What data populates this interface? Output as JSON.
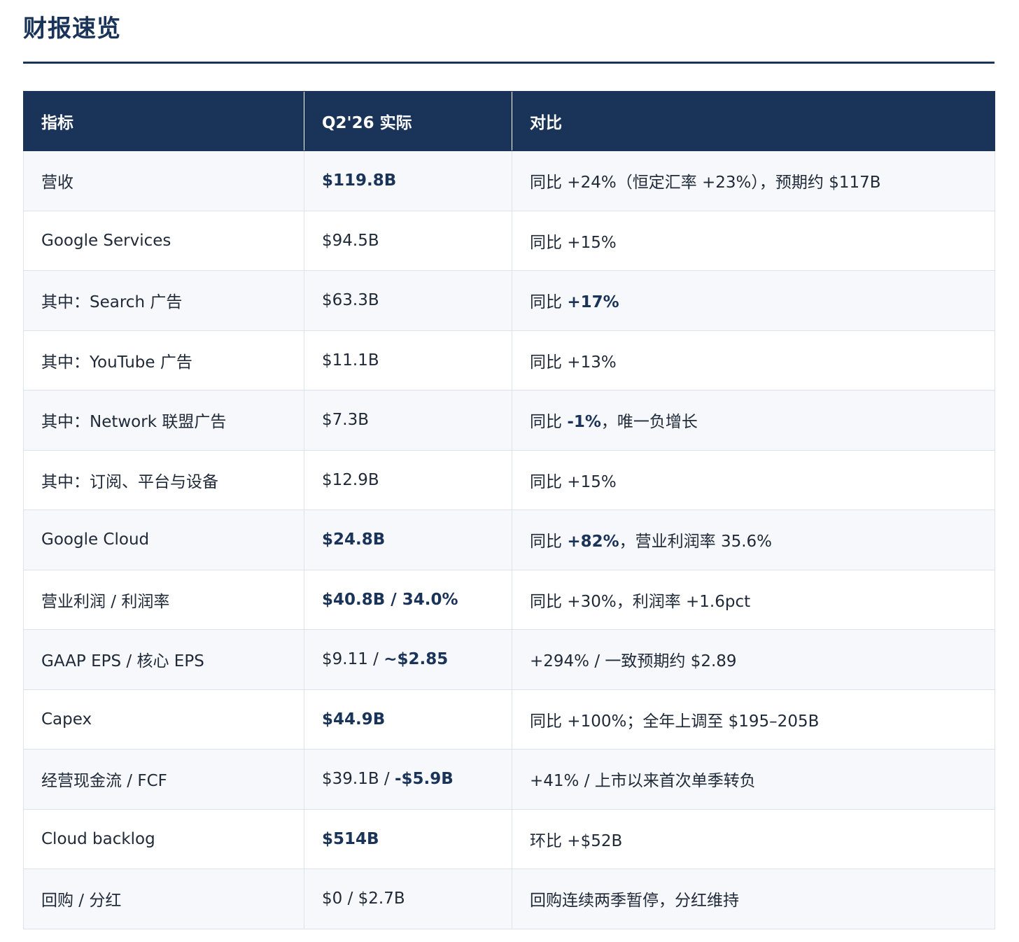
{
  "page": {
    "title": "财报速览"
  },
  "table": {
    "headers": [
      "指标",
      "Q2'26 实际",
      "对比"
    ],
    "rows": [
      {
        "metric": "营收",
        "actual": [
          {
            "text": "$119.8B",
            "bold": true
          }
        ],
        "comparison": [
          {
            "text": "同比 +24%（恒定汇率 +23%），预期约 $117B",
            "bold": false
          }
        ]
      },
      {
        "metric": "Google Services",
        "actual": [
          {
            "text": "$94.5B",
            "bold": false
          }
        ],
        "comparison": [
          {
            "text": "同比 +15%",
            "bold": false
          }
        ]
      },
      {
        "metric": "其中：Search 广告",
        "actual": [
          {
            "text": "$63.3B",
            "bold": false
          }
        ],
        "comparison": [
          {
            "text": "同比 ",
            "bold": false
          },
          {
            "text": "+17%",
            "bold": true
          }
        ]
      },
      {
        "metric": "其中：YouTube 广告",
        "actual": [
          {
            "text": "$11.1B",
            "bold": false
          }
        ],
        "comparison": [
          {
            "text": "同比 +13%",
            "bold": false
          }
        ]
      },
      {
        "metric": "其中：Network 联盟广告",
        "actual": [
          {
            "text": "$7.3B",
            "bold": false
          }
        ],
        "comparison": [
          {
            "text": "同比 ",
            "bold": false
          },
          {
            "text": "-1%",
            "bold": true
          },
          {
            "text": "，唯一负增长",
            "bold": false
          }
        ]
      },
      {
        "metric": "其中：订阅、平台与设备",
        "actual": [
          {
            "text": "$12.9B",
            "bold": false
          }
        ],
        "comparison": [
          {
            "text": "同比 +15%",
            "bold": false
          }
        ]
      },
      {
        "metric": "Google Cloud",
        "actual": [
          {
            "text": "$24.8B",
            "bold": true
          }
        ],
        "comparison": [
          {
            "text": "同比 ",
            "bold": false
          },
          {
            "text": "+82%",
            "bold": true
          },
          {
            "text": "，营业利润率 35.6%",
            "bold": false
          }
        ]
      },
      {
        "metric": "营业利润 / 利润率",
        "actual": [
          {
            "text": "$40.8B / 34.0%",
            "bold": true
          }
        ],
        "comparison": [
          {
            "text": "同比 +30%，利润率 +1.6pct",
            "bold": false
          }
        ]
      },
      {
        "metric": "GAAP EPS / 核心 EPS",
        "actual": [
          {
            "text": "$9.11 / ",
            "bold": false
          },
          {
            "text": "~$2.85",
            "bold": true
          }
        ],
        "comparison": [
          {
            "text": "+294% / 一致预期约 $2.89",
            "bold": false
          }
        ]
      },
      {
        "metric": "Capex",
        "actual": [
          {
            "text": "$44.9B",
            "bold": true
          }
        ],
        "comparison": [
          {
            "text": "同比 +100%；全年上调至 $195–205B",
            "bold": false
          }
        ]
      },
      {
        "metric": "经营现金流 / FCF",
        "actual": [
          {
            "text": "$39.1B / ",
            "bold": false
          },
          {
            "text": "-$5.9B",
            "bold": true
          }
        ],
        "comparison": [
          {
            "text": "+41% / 上市以来首次单季转负",
            "bold": false
          }
        ]
      },
      {
        "metric": "Cloud backlog",
        "actual": [
          {
            "text": "$514B",
            "bold": true
          }
        ],
        "comparison": [
          {
            "text": "环比 +$52B",
            "bold": false
          }
        ]
      },
      {
        "metric": "回购 / 分红",
        "actual": [
          {
            "text": "$0 / $2.7B",
            "bold": false
          }
        ],
        "comparison": [
          {
            "text": "回购连续两季暂停，分红维持",
            "bold": false
          }
        ]
      }
    ]
  },
  "colors": {
    "header_bg": "#1a3358",
    "accent_text": "#1a3358",
    "row_alt_bg": "#f6f8fb",
    "border": "#dde3ea"
  }
}
